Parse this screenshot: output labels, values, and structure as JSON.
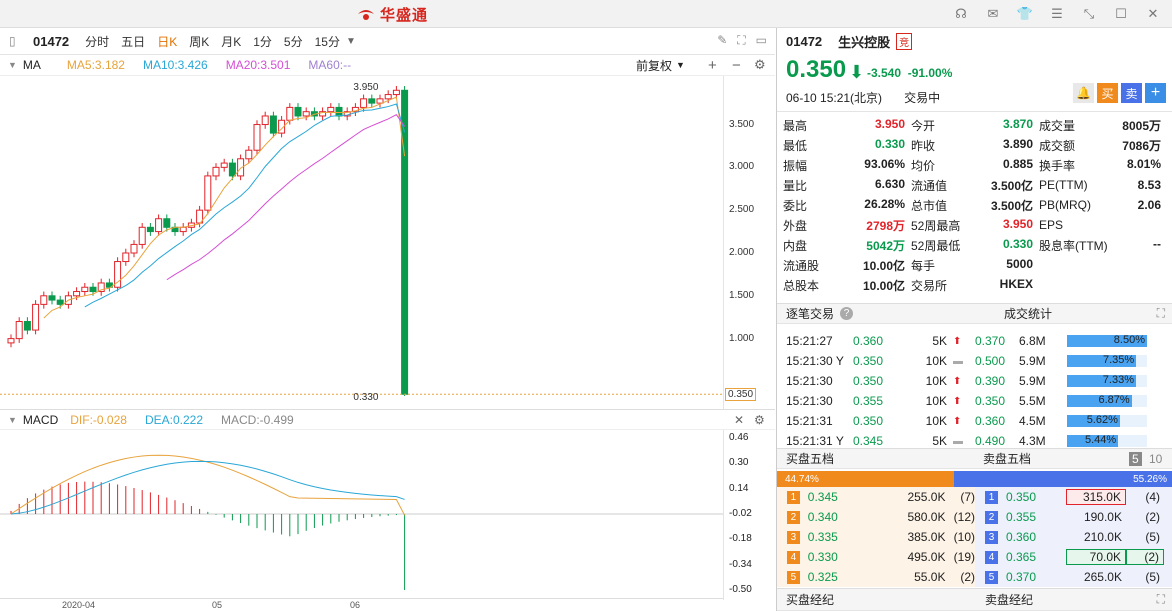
{
  "app": {
    "title": "华盛通"
  },
  "toolbar": {
    "code": "01472",
    "tabs": [
      "分时",
      "五日",
      "日K",
      "周K",
      "月K",
      "1分",
      "5分",
      "15分"
    ],
    "active": "日K"
  },
  "ma": {
    "label": "MA",
    "ma5": "MA5:3.182",
    "ma10": "MA10:3.426",
    "ma20": "MA20:3.501",
    "ma60": "MA60:--",
    "adjust": "前复权"
  },
  "macd": {
    "label": "MACD",
    "dif": "DIF:-0.028",
    "dea": "DEA:0.222",
    "macd": "MACD:-0.499"
  },
  "colors": {
    "up": "#e2232a",
    "down": "#0a9a4e",
    "ma5": "#e8a33c",
    "ma10": "#2aa7d6",
    "ma20": "#d54fd5",
    "ma60": "#a080d0"
  },
  "chart_data": {
    "type": "candlestick",
    "ylim": [
      0.33,
      3.95
    ],
    "yticks": [
      "3.500",
      "3.000",
      "2.500",
      "2.000",
      "1.500",
      "1.000",
      "0.350"
    ],
    "high_label": "3.950",
    "low_label": "0.330",
    "macd_ticks": [
      "0.46",
      "0.30",
      "0.14",
      "-0.02",
      "-0.18",
      "-0.34",
      "-0.50"
    ],
    "x_ticks": [
      "2020-04",
      "05",
      "06"
    ],
    "closes": [
      1.0,
      1.2,
      1.1,
      1.4,
      1.5,
      1.45,
      1.4,
      1.5,
      1.55,
      1.6,
      1.55,
      1.65,
      1.6,
      1.9,
      2.0,
      2.1,
      2.3,
      2.25,
      2.4,
      2.3,
      2.25,
      2.3,
      2.35,
      2.5,
      2.9,
      3.0,
      3.05,
      2.9,
      3.1,
      3.2,
      3.5,
      3.6,
      3.4,
      3.55,
      3.7,
      3.6,
      3.65,
      3.6,
      3.65,
      3.7,
      3.6,
      3.65,
      3.7,
      3.8,
      3.75,
      3.8,
      3.85,
      3.9,
      0.35
    ]
  },
  "quote": {
    "code": "01472",
    "name": "生兴控股",
    "badge": "竞",
    "price": "0.350",
    "change": "-3.540",
    "pct": "-91.00%",
    "time": "06-10  15:21(北京)",
    "status": "交易中",
    "buy": "买",
    "sell": "卖"
  },
  "stats": [
    [
      "最高",
      "3.950",
      "今开",
      "3.870",
      "成交量",
      "8005万"
    ],
    [
      "最低",
      "0.330",
      "昨收",
      "3.890",
      "成交额",
      "7086万"
    ],
    [
      "振幅",
      "93.06%",
      "均价",
      "0.885",
      "换手率",
      "8.01%"
    ],
    [
      "量比",
      "6.630",
      "流通值",
      "3.500亿",
      "PE(TTM)",
      "8.53"
    ],
    [
      "委比",
      "26.28%",
      "总市值",
      "3.500亿",
      "PB(MRQ)",
      "2.06"
    ],
    [
      "外盘",
      "2798万",
      "52周最高",
      "3.950",
      "EPS",
      ""
    ],
    [
      "内盘",
      "5042万",
      "52周最低",
      "0.330",
      "股息率(TTM)",
      "--"
    ],
    [
      "流通股",
      "10.00亿",
      "每手",
      "5000",
      "",
      ""
    ],
    [
      "总股本",
      "10.00亿",
      "交易所",
      "HKEX",
      "",
      ""
    ]
  ],
  "trades": {
    "title": "逐笔交易",
    "stat_title": "成交统计",
    "rows": [
      [
        "15:21:27",
        "0.360",
        "5K",
        "up",
        "0.370",
        "6.8M",
        "8.50%"
      ],
      [
        "15:21:30 Y",
        "0.350",
        "10K",
        "flat",
        "0.500",
        "5.9M",
        "7.35%"
      ],
      [
        "15:21:30",
        "0.350",
        "10K",
        "up",
        "0.390",
        "5.9M",
        "7.33%"
      ],
      [
        "15:21:30",
        "0.355",
        "10K",
        "up",
        "0.350",
        "5.5M",
        "6.87%"
      ],
      [
        "15:21:31",
        "0.350",
        "10K",
        "up",
        "0.360",
        "4.5M",
        "5.62%"
      ],
      [
        "15:21:31 Y",
        "0.345",
        "5K",
        "flat",
        "0.490",
        "4.3M",
        "5.44%"
      ]
    ]
  },
  "book": {
    "buy_title": "买盘五档",
    "sell_title": "卖盘五档",
    "buy_ratio": "44.74%",
    "sell_ratio": "55.26%",
    "levels": [
      "5",
      "10"
    ],
    "buys": [
      [
        "1",
        "0.345",
        "255.0K",
        "(7)"
      ],
      [
        "2",
        "0.340",
        "580.0K",
        "(12)"
      ],
      [
        "3",
        "0.335",
        "385.0K",
        "(10)"
      ],
      [
        "4",
        "0.330",
        "495.0K",
        "(19)"
      ],
      [
        "5",
        "0.325",
        "55.0K",
        "(2)"
      ]
    ],
    "sells": [
      [
        "1",
        "0.350",
        "315.0K",
        "(4)"
      ],
      [
        "2",
        "0.355",
        "190.0K",
        "(2)"
      ],
      [
        "3",
        "0.360",
        "210.0K",
        "(5)"
      ],
      [
        "4",
        "0.365",
        "70.0K",
        "(2)"
      ],
      [
        "5",
        "0.370",
        "265.0K",
        "(5)"
      ]
    ]
  },
  "brokers": {
    "buy": "买盘经纪",
    "sell": "卖盘经纪"
  }
}
